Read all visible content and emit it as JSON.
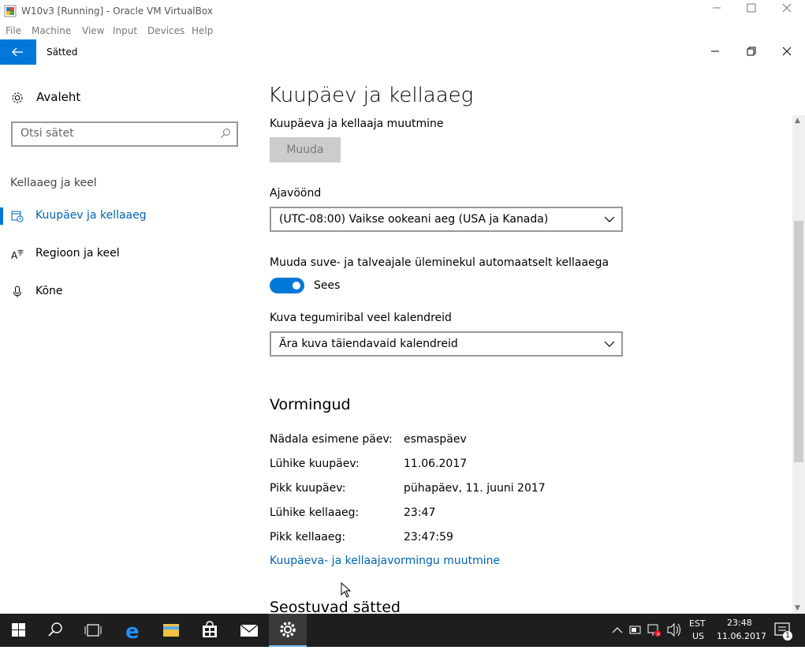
{
  "vbox": {
    "title": "W10v3 [Running] - Oracle VM VirtualBox",
    "menu": [
      "File",
      "Machine",
      "View",
      "Input",
      "Devices",
      "Help"
    ]
  },
  "settings_window": {
    "title": "Sätted"
  },
  "sidebar": {
    "home_label": "Avaleht",
    "search_placeholder": "Otsi sätet",
    "section_label": "Kellaaeg ja keel",
    "items": [
      {
        "label": "Kuupäev ja kellaaeg",
        "icon": "calendar-clock-icon",
        "selected": true
      },
      {
        "label": "Regioon ja keel",
        "icon": "language-icon",
        "selected": false
      },
      {
        "label": "Kõne",
        "icon": "microphone-icon",
        "selected": false
      }
    ]
  },
  "main": {
    "page_title": "Kuupäev ja kellaaeg",
    "change_label": "Kuupäeva ja kellaaja muutmine",
    "change_button": "Muuda",
    "timezone_label": "Ajavöönd",
    "timezone_value": "(UTC-08:00) Vaikse ookeani aeg (USA ja Kanada)",
    "dst_label": "Muuda suve- ja talveajale üleminekul automaatselt kellaaega",
    "dst_toggle_state": "Sees",
    "calendars_label": "Kuva tegumiribal veel kalendreid",
    "calendars_value": "Ära kuva täiendavaid kalendreid",
    "formats_heading": "Vormingud",
    "formats": [
      {
        "key": "Nädala esimene päev:",
        "value": "esmaspäev"
      },
      {
        "key": "Lühike kuupäev:",
        "value": "11.06.2017"
      },
      {
        "key": "Pikk kuupäev:",
        "value": "pühapäev, 11. juuni 2017"
      },
      {
        "key": "Lühike kellaaeg:",
        "value": "23:47"
      },
      {
        "key": "Pikk kellaaeg:",
        "value": "23:47:59"
      }
    ],
    "formats_link": "Kuupäeva- ja kellaajavormingu muutmine",
    "related_heading": "Seostuvad sätted"
  },
  "taskbar": {
    "lang_top": "EST",
    "lang_bottom": "US",
    "time": "23:48",
    "date": "11.06.2017",
    "notification_count": "1"
  },
  "colors": {
    "accent": "#0078d7",
    "link": "#0063b1",
    "taskbar": "#1e1e1e"
  }
}
